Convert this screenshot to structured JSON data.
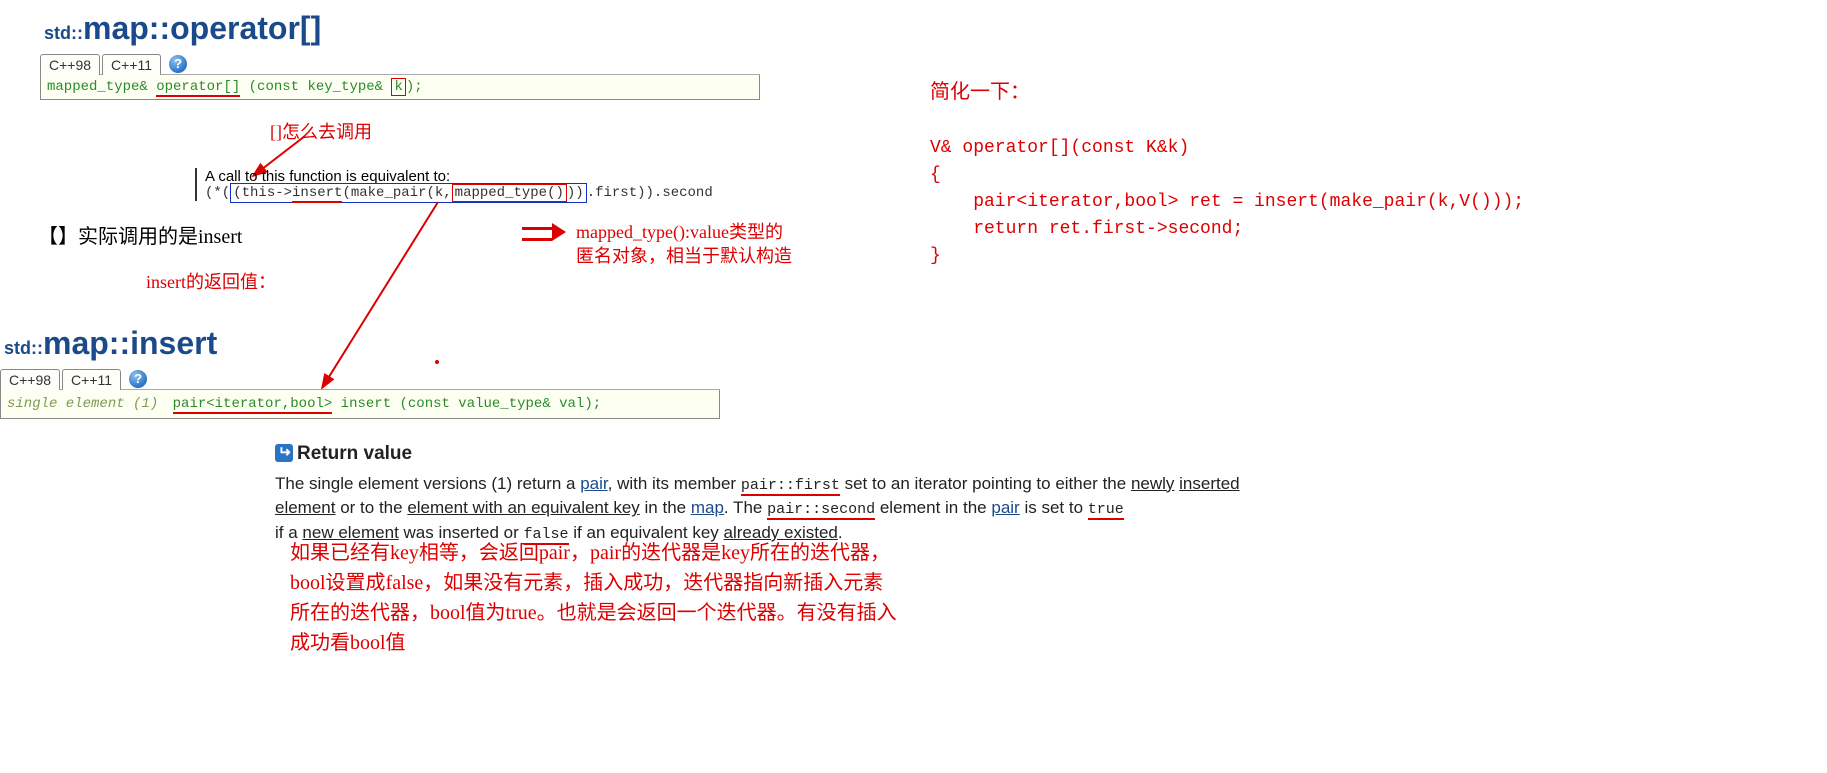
{
  "op_section": {
    "std_prefix": "std::",
    "class": "map",
    "sep": "::",
    "method": "operator[]",
    "tabs": [
      "C++98",
      "C++11"
    ],
    "signature_pre": "mapped_type& ",
    "signature_op": "operator[]",
    "signature_mid": " (const key_type& ",
    "signature_k": "k",
    "signature_post": ");"
  },
  "annot": {
    "bracket_call": "[]怎么去调用",
    "actual_call": "【】实际调用的是insert",
    "mapped_type_note1": "mapped_type():value类型的",
    "mapped_type_note2": "匿名对象，相当于默认构造",
    "insert_ret_label": "insert的返回值："
  },
  "equivalent": {
    "intro": "A call to this function is equivalent to:",
    "pre": "(*(",
    "box_pre": "(this->",
    "underlined": "insert",
    "mid1": "(make_pair(k,",
    "boxed": "mapped_type()",
    "mid2": "))",
    "post_outer1": ".first)).second"
  },
  "insert_section": {
    "std_prefix": "std::",
    "class": "map",
    "sep": "::",
    "method": "insert",
    "tabs": [
      "C++98",
      "C++11"
    ],
    "sig_left": "single element (1)",
    "sig_ret": "pair<iterator,bool>",
    "sig_rest": " insert (const value_type& val);"
  },
  "return_value": {
    "heading": "Return value",
    "text_p1a": "The single element versions (1) return a ",
    "pair": "pair",
    "text_p1b": ", with its member ",
    "pairfirst": "pair::first",
    "text_p1c": " set to an iterator pointing to either the ",
    "newly_inserted_prefix": "newly",
    "newly_inserted_rest": "inserted element",
    "text_p1d": " or to the ",
    "eq_key": "element with an equivalent key",
    "text_p1e": " in the ",
    "map_link": "map",
    "text_p1f": ". The ",
    "pairsecond": "pair::second",
    "text_p1g": " element in the ",
    "pair2": "pair",
    "text_p1h": " is set to ",
    "true_w": "true",
    "text_p2a": "if a ",
    "new_element": "new element",
    "text_p2b": " was inserted or ",
    "false_w": "false",
    "text_p2c": " if an equivalent key ",
    "already_existed": "already existed",
    "period": "."
  },
  "cn_explain": {
    "l1": "如果已经有key相等，会返回pair，pair的迭代器是key所在的迭代器，",
    "l2": "bool设置成false，如果没有元素，插入成功，迭代器指向新插入元素",
    "l3": "所在的迭代器，bool值为true。也就是会返回一个迭代器。有没有插入",
    "l4": "成功看bool值"
  },
  "right_code": {
    "intro": "简化一下：",
    "l1": "V& operator[](const K&k)",
    "l2": "{",
    "l3": "    pair<iterator,bool> ret = insert(make_pair(k,V()));",
    "l4": "    return ret.first->second;",
    "l5": "}"
  }
}
